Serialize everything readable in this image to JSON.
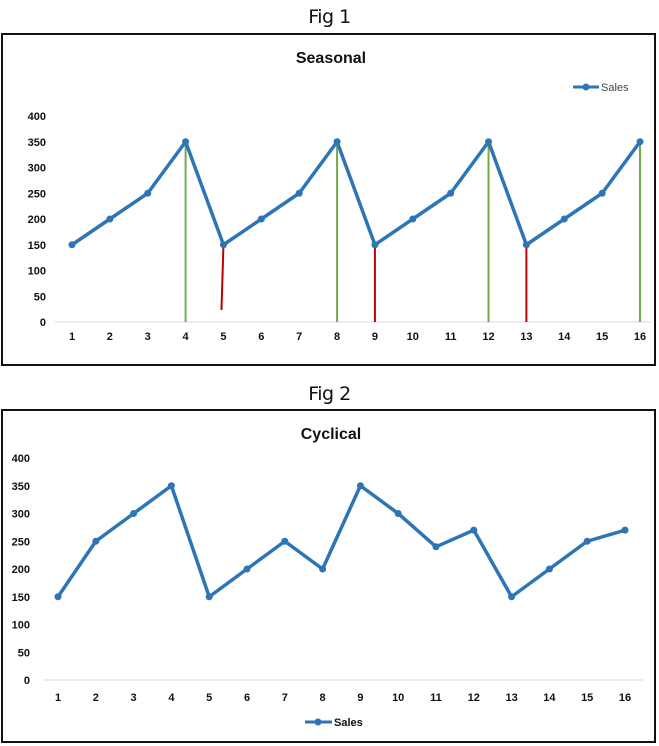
{
  "figures": [
    {
      "label": "Fig 1"
    },
    {
      "label": "Fig 2"
    }
  ],
  "chart_data": [
    {
      "type": "line",
      "title": "Seasonal",
      "xlabel": "",
      "ylabel": "",
      "categories": [
        "1",
        "2",
        "3",
        "4",
        "5",
        "6",
        "7",
        "8",
        "9",
        "10",
        "11",
        "12",
        "13",
        "14",
        "15",
        "16"
      ],
      "yticks": [
        "0",
        "50",
        "100",
        "150",
        "200",
        "250",
        "300",
        "350",
        "400"
      ],
      "ylim": [
        0,
        400
      ],
      "grid": false,
      "legend": {
        "position": "top-right",
        "entries": [
          "Sales"
        ]
      },
      "series": [
        {
          "name": "Sales",
          "color": "#2e75b6",
          "values": [
            150,
            200,
            250,
            350,
            150,
            200,
            250,
            350,
            150,
            200,
            250,
            350,
            150,
            200,
            250,
            350
          ]
        }
      ],
      "annotations": {
        "peak_drop_lines": {
          "color": "#70ad47",
          "x": [
            4,
            8,
            12,
            16
          ],
          "from": 0,
          "to": 350
        },
        "trough_drop_lines": {
          "color": "#c00000",
          "x": [
            5,
            9,
            13
          ],
          "from": 0,
          "to": 150
        }
      }
    },
    {
      "type": "line",
      "title": "Cyclical",
      "xlabel": "",
      "ylabel": "",
      "categories": [
        "1",
        "2",
        "3",
        "4",
        "5",
        "6",
        "7",
        "8",
        "9",
        "10",
        "11",
        "12",
        "13",
        "14",
        "15",
        "16"
      ],
      "yticks": [
        "0",
        "50",
        "100",
        "150",
        "200",
        "250",
        "300",
        "350",
        "400"
      ],
      "ylim": [
        0,
        400
      ],
      "grid": false,
      "legend": {
        "position": "bottom",
        "entries": [
          "Sales"
        ]
      },
      "series": [
        {
          "name": "Sales",
          "color": "#2e75b6",
          "values": [
            150,
            250,
            300,
            350,
            150,
            200,
            250,
            200,
            350,
            300,
            240,
            270,
            150,
            200,
            250,
            270
          ]
        }
      ]
    }
  ]
}
